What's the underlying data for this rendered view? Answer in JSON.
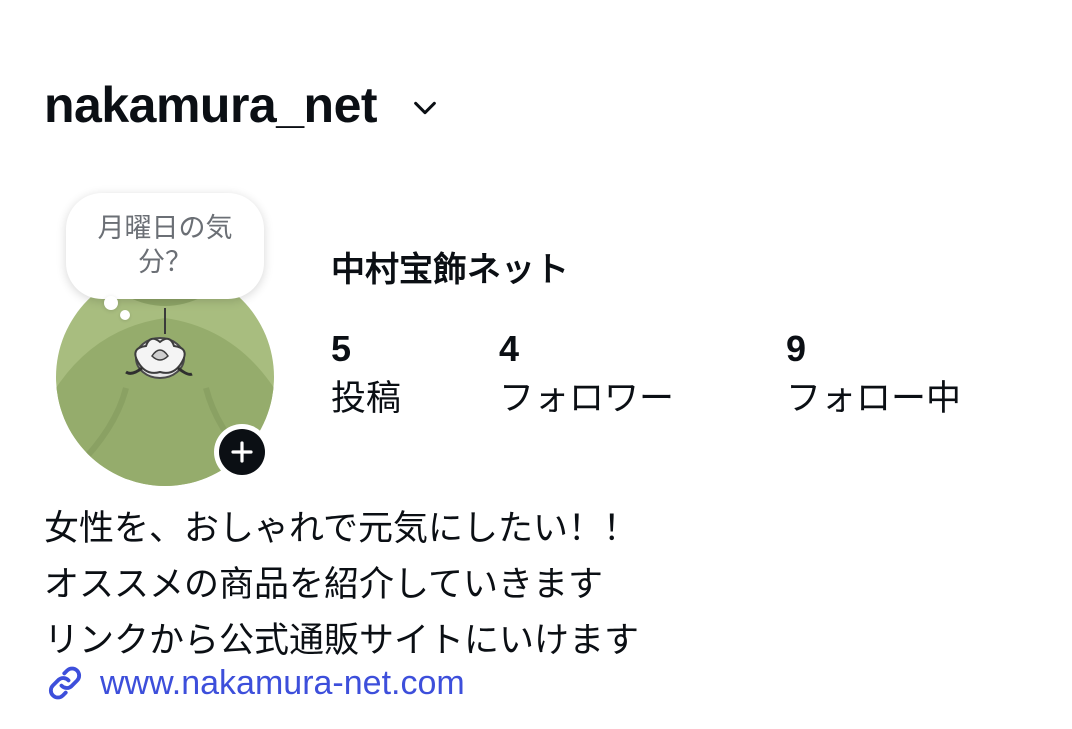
{
  "header": {
    "username": "nakamura_net",
    "chevron_icon": "chevron-down-icon"
  },
  "profile": {
    "note": "月曜日の気分？",
    "display_name": "中村宝飾ネット",
    "avatar_colors": {
      "background": "#95ac6c",
      "shade": "#7f9659"
    },
    "add_icon": "plus-icon"
  },
  "stats": {
    "posts": {
      "count": "5",
      "label": "投稿"
    },
    "followers": {
      "count": "4",
      "label": "フォロワー"
    },
    "following": {
      "count": "9",
      "label": "フォロー中"
    }
  },
  "bio": {
    "lines": [
      "女性を、おしゃれで元気にしたい！！",
      "オススメの商品を紹介していきます",
      "リンクから公式通販サイトにいけます"
    ]
  },
  "link": {
    "icon": "link-icon",
    "text": "www.nakamura-net.com",
    "color": "#3d4fdb"
  }
}
